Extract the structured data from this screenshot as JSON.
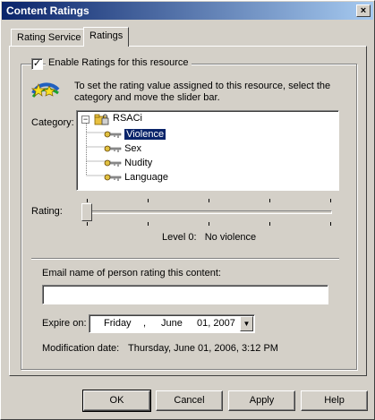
{
  "window": {
    "title": "Content Ratings",
    "close_glyph": "×"
  },
  "tabs": [
    {
      "label": "Rating Service",
      "active": false
    },
    {
      "label": "Ratings",
      "active": true
    }
  ],
  "ratings": {
    "enable_checkbox": {
      "label": "Enable Ratings for this resource",
      "checked": true,
      "glyph": "✓"
    },
    "instructions_line1": "To set the rating value assigned to this resource, select the",
    "instructions_line2": "category and move the slider bar.",
    "category_label": "Category:",
    "tree": {
      "root": "RSACi",
      "expander": "−",
      "items": [
        {
          "label": "Violence",
          "selected": true
        },
        {
          "label": "Sex",
          "selected": false
        },
        {
          "label": "Nudity",
          "selected": false
        },
        {
          "label": "Language",
          "selected": false
        }
      ]
    },
    "rating_label": "Rating:",
    "slider": {
      "value": 0,
      "max": 4
    },
    "level_text": "Level 0:   No violence"
  },
  "email": {
    "label": "Email name of person rating this content:",
    "value": ""
  },
  "expire": {
    "label": "Expire on:",
    "day": "Friday",
    "sep1": ",",
    "month": "June",
    "date": "01, 2007",
    "dropdown_glyph": "▼"
  },
  "modification": {
    "label": "Modification date:",
    "value": "Thursday, June 01, 2006, 3:12 PM"
  },
  "buttons": {
    "ok": "OK",
    "cancel": "Cancel",
    "apply": "Apply",
    "help": "Help"
  },
  "colors": {
    "selection": "#0a246a",
    "face": "#d4d0c8",
    "title_start": "#0a246a",
    "title_end": "#a6caf0"
  }
}
